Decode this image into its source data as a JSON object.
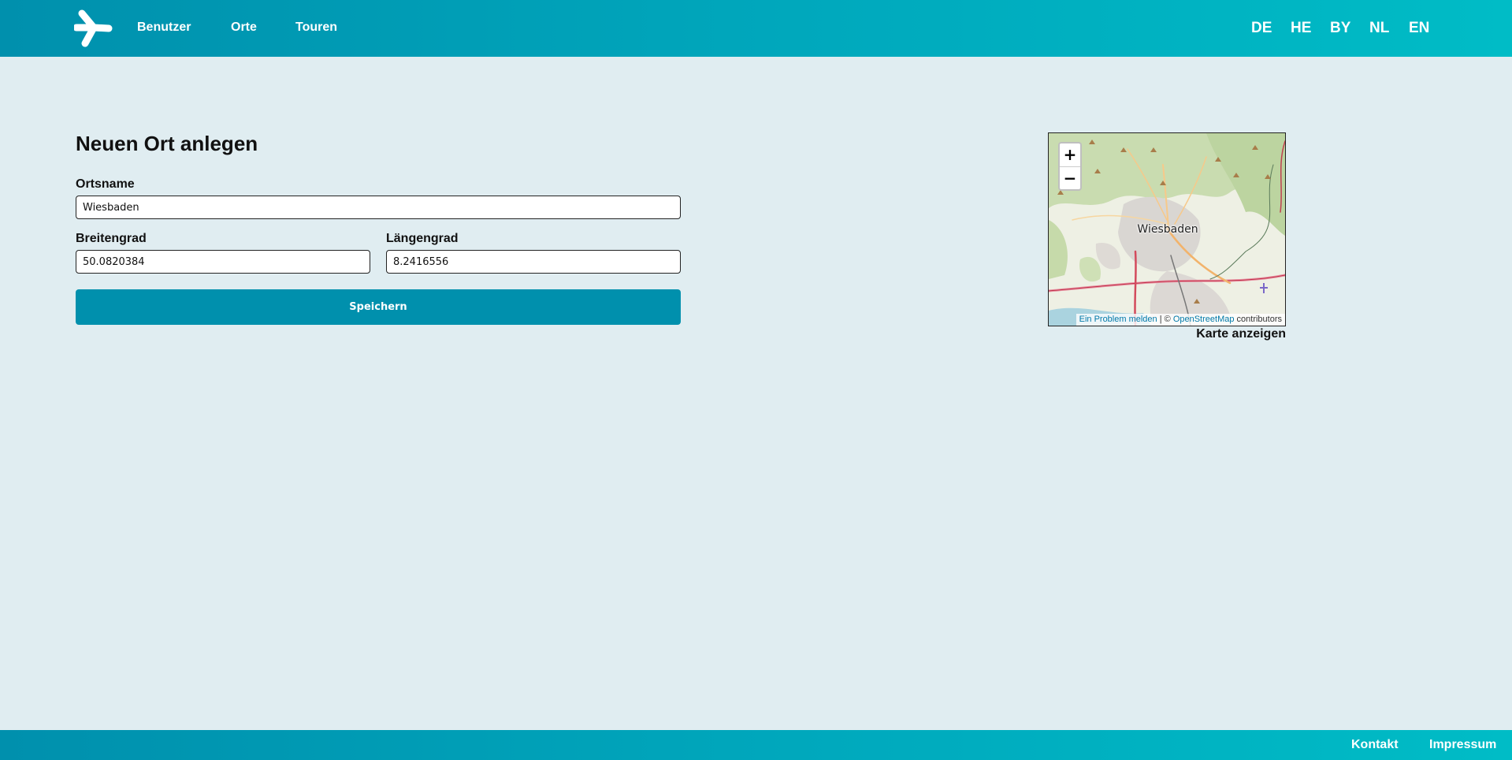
{
  "header": {
    "nav": [
      "Benutzer",
      "Orte",
      "Touren"
    ],
    "languages": [
      "DE",
      "HE",
      "BY",
      "NL",
      "EN"
    ]
  },
  "form": {
    "title": "Neuen Ort anlegen",
    "name_label": "Ortsname",
    "name_value": "Wiesbaden",
    "lat_label": "Breitengrad",
    "lat_value": "50.0820384",
    "lng_label": "Längengrad",
    "lng_value": "8.2416556",
    "save_label": "Speichern"
  },
  "map": {
    "zoom_in": "+",
    "zoom_out": "−",
    "city_label": "Wiesbaden",
    "attribution_link1": "Ein Problem melden",
    "attribution_sep": " | © ",
    "attribution_link2": "OpenStreetMap",
    "attribution_suffix": " contributors",
    "show_map_label": "Karte anzeigen"
  },
  "footer": {
    "links": [
      "Kontakt",
      "Impressum"
    ]
  },
  "colors": {
    "brand": "#0090ad",
    "background": "#e0edf1"
  }
}
